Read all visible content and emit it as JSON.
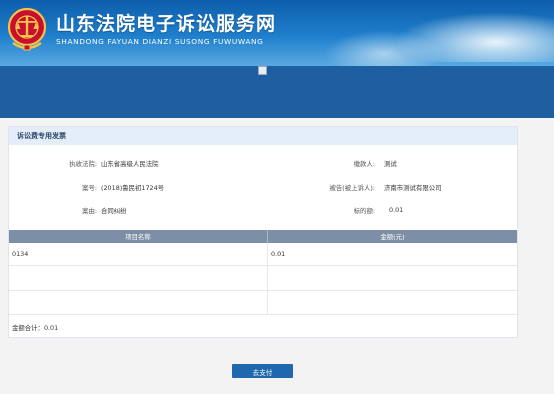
{
  "header": {
    "title": "山东法院电子诉讼服务网",
    "subtitle": "SHANDONG FAYUAN DIANZI SUSONG FUWUWANG",
    "accent_color": "#1f7fcc",
    "emblem_icon": "court-emblem-icon"
  },
  "banner": {
    "broken_image_icon": "broken-image-icon"
  },
  "panel": {
    "title": "诉讼费专用发票",
    "fields": {
      "court_label": "执收法院:",
      "court_value": "山东省高级人民法院",
      "payer_label": "缴款人:",
      "payer_value": "测试",
      "case_no_label": "案号:",
      "case_no_value": "(2018)鲁民初1724号",
      "defendant_label": "被告(被上诉人):",
      "defendant_value": "济南市测试有限公司",
      "cause_label": "案由:",
      "cause_value": "合同纠纷",
      "amount_label": "标的额:",
      "amount_value": "0.01"
    },
    "table": {
      "columns": [
        "项目名称",
        "金额(元)"
      ],
      "rows": [
        [
          "0134",
          "0.01"
        ],
        [
          "",
          ""
        ],
        [
          "",
          ""
        ]
      ],
      "total_label": "金额合计：0.01"
    }
  },
  "actions": {
    "pay_label": "去支付"
  }
}
